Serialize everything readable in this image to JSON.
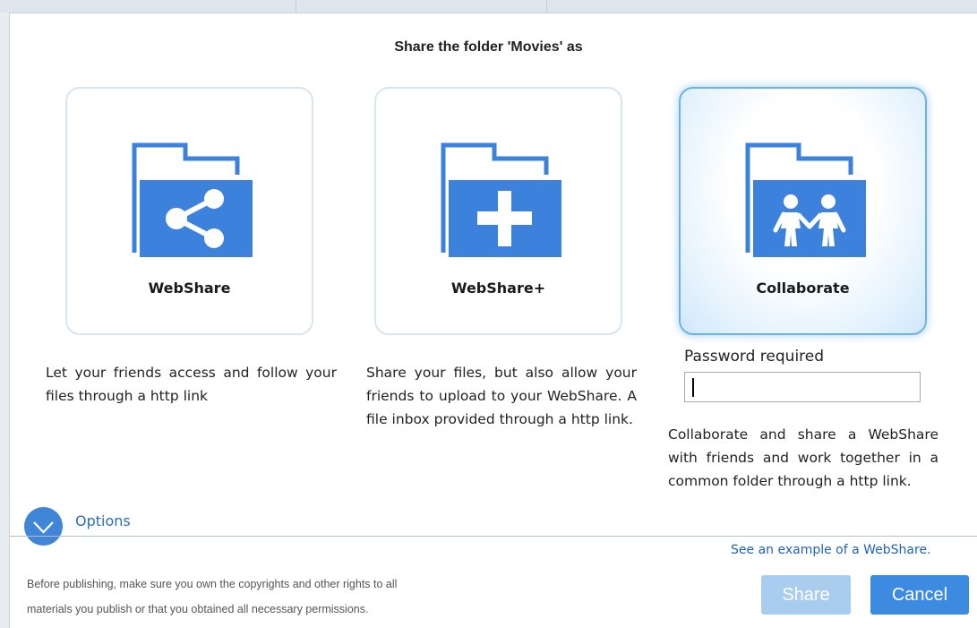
{
  "title": "Share the folder 'Movies' as",
  "cards": [
    {
      "label": "WebShare",
      "icon": "folder-share-icon",
      "description": "Let your friends access and follow your files through a http link"
    },
    {
      "label": "WebShare+",
      "icon": "folder-plus-icon",
      "description": "Share your files, but also allow your friends to upload to your WebShare. A file inbox provided through a http link."
    },
    {
      "label": "Collaborate",
      "icon": "folder-people-icon",
      "description": "Collaborate and share a WebShare with friends and work together in a common folder through a http link.",
      "selected": true
    }
  ],
  "password": {
    "label": "Password required",
    "value": "",
    "placeholder": ""
  },
  "options": {
    "label": "Options",
    "icon": "chevron-down-icon"
  },
  "example_link": "See an example of a WebShare.",
  "disclaimer": {
    "line1": "Before publishing, make sure you own the copyrights and other rights to all",
    "line2": "materials you publish or that you obtained all necessary permissions."
  },
  "buttons": {
    "share": "Share",
    "cancel": "Cancel"
  },
  "colors": {
    "accent": "#3c8be0",
    "icon_blue": "#3c82dc",
    "share_disabled": "#a9cdee",
    "link": "#1f63b5"
  }
}
